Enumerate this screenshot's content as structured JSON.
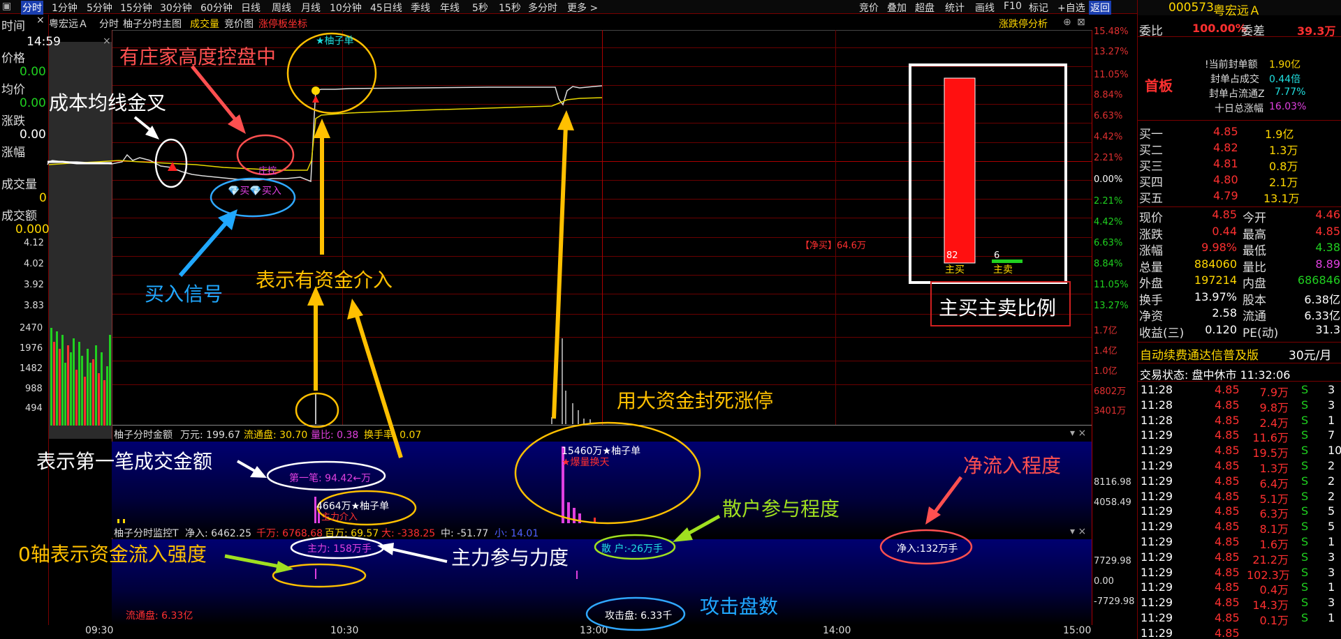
{
  "topbar": {
    "corner": "▣",
    "periods": [
      "分时",
      "1分钟",
      "5分钟",
      "15分钟",
      "30分钟",
      "60分钟",
      "日线",
      "周线",
      "月线",
      "10分钟",
      "45日线",
      "季线",
      "年线",
      "5秒",
      "15秒",
      "多分时",
      "更多 >"
    ],
    "right_buttons": [
      "竞价",
      "叠加",
      "超盘",
      "统计",
      "画线",
      "F10",
      "标记",
      "+自选",
      "返回"
    ]
  },
  "chart_header": {
    "time_label": "时间",
    "close": "×",
    "stock_name": "粤宏远Ａ",
    "mode": "分时",
    "main": "柚子分时主图",
    "vol": "成交量",
    "bid": "竞价图",
    "coord": "涨停板坐标",
    "analysis": "涨跌停分析"
  },
  "left_values": {
    "time": "14:59",
    "price_label": "价格",
    "price": "0.00",
    "avg_label": "均价",
    "avg": "0.00",
    "chg_label": "涨跌",
    "chg": "0.00",
    "pct_label": "涨幅",
    "pct": "0.00",
    "vol_label": "成交量",
    "vol": "0",
    "amt_label": "成交额",
    "amt": "0.000"
  },
  "left_price_ticks": [
    "4.12",
    "4.02",
    "3.92",
    "3.83"
  ],
  "left_vol_ticks": [
    "2470",
    "1976",
    "1482",
    "988",
    "494"
  ],
  "right_pct_ticks": [
    "15.48%",
    "13.27%",
    "11.05%",
    "8.84%",
    "6.63%",
    "4.42%",
    "2.21%",
    "0.00%",
    "2.21%",
    "4.42%",
    "6.63%",
    "8.84%",
    "11.05%",
    "13.27%"
  ],
  "right_vol_ticks": [
    "1.7亿",
    "1.4亿",
    "1.0亿",
    "6802万",
    "3401万"
  ],
  "chart_labels": {
    "star_single": "★柚子单",
    "retail_inline": "净买",
    "net_buy": "【净买】64.6万",
    "buy_signal_text": "买入",
    "gold_cross_text": "庄控"
  },
  "bar_panel": {
    "main_buy": "主买",
    "main_sell": "主卖",
    "main_buy_val": "82",
    "main_sell_val": "6"
  },
  "ind1": {
    "title": "柚子分时金额",
    "unit": "万元: 199.67",
    "float": "流通盘: 30.70",
    "vol_ratio": "量比: 0.38",
    "turnover": "换手率: 0.07",
    "axis_hi": "8116.98",
    "axis_mid": "4058.49",
    "first": "第一笔: 94.42←万",
    "big1": "4664万★柚子单",
    "big1b": "主力介入",
    "big2": "15460万★柚子单",
    "big2b": "★爆量换天"
  },
  "ind2": {
    "title": "柚子分时监控T",
    "net": "净入: 6462.25",
    "k": "千万: 6768.68",
    "b": "百万: 69.57",
    "big": "大: -338.25",
    "mid": "中: -51.77",
    "small": "小: 14.01",
    "main_force": "主力: 158万手",
    "retail": "散 户:-26万手",
    "netin": "净入:132万手",
    "attack": "攻击盘: 6.33千",
    "float": "流通盘: 6.33亿",
    "axis_hi": "7729.98",
    "axis_mid": "0.00",
    "axis_lo": "-7729.98"
  },
  "time_axis": [
    "09:30",
    "10:30",
    "13:00",
    "14:00",
    "15:00"
  ],
  "annotations": {
    "zhuang": "有庄家高度控盘中",
    "cost": "成本均线金叉",
    "buy": "买入信号",
    "fund": "表示有资金介入",
    "seal": "用大资金封死涨停",
    "first": "表示第一笔成交金额",
    "zero": "0轴表示资金流入强度",
    "main_force": "主力参与力度",
    "retail": "散户参与程度",
    "netflow": "净流入程度",
    "attack": "攻击盘数",
    "ratio": "主买主卖比例"
  },
  "sidebar": {
    "code": "000573",
    "name": "粤宏远Ａ",
    "wb_label": "委比",
    "wb": "100.00%",
    "wc_label": "委差",
    "wc": "39.3万",
    "first_board": "首板",
    "seal_info": [
      {
        "label": "!当前封单额",
        "value": "1.90亿"
      },
      {
        "label": "封单占成交",
        "value": "0.44倍"
      },
      {
        "label": "封单占流通Z",
        "value": "7.77%"
      },
      {
        "label": "十日总涨幅",
        "value": "16.03%"
      }
    ],
    "bids": [
      {
        "label": "买一",
        "price": "4.85",
        "vol": "1.9亿"
      },
      {
        "label": "买二",
        "price": "4.82",
        "vol": "1.3万"
      },
      {
        "label": "买三",
        "price": "4.81",
        "vol": "0.8万"
      },
      {
        "label": "买四",
        "price": "4.80",
        "vol": "2.1万"
      },
      {
        "label": "买五",
        "price": "4.79",
        "vol": "13.1万"
      }
    ],
    "quote": [
      {
        "l1": "现价",
        "v1": "4.85",
        "l2": "今开",
        "v2": "4.46"
      },
      {
        "l1": "涨跌",
        "v1": "0.44",
        "l2": "最高",
        "v2": "4.85"
      },
      {
        "l1": "涨幅",
        "v1": "9.98%",
        "l2": "最低",
        "v2": "4.38"
      },
      {
        "l1": "总量",
        "v1": "884060",
        "l2": "量比",
        "v2": "8.89"
      },
      {
        "l1": "外盘",
        "v1": "197214",
        "l2": "内盘",
        "v2": "686846"
      },
      {
        "l1": "换手",
        "v1": "13.97%",
        "l2": "股本",
        "v2": "6.38亿"
      },
      {
        "l1": "净资",
        "v1": "2.58",
        "l2": "流通",
        "v2": "6.33亿"
      },
      {
        "l1": "收益(三)",
        "v1": "0.120",
        "l2": "PE(动)",
        "v2": "31.3"
      }
    ],
    "promo": "自动续费通达信普及版",
    "promo_price": "30元/月",
    "status": "交易状态: 盘中休市 11:32:06",
    "trades": [
      {
        "t": "11:28",
        "p": "4.85",
        "v": "7.9万",
        "s": "S",
        "n": "3"
      },
      {
        "t": "11:28",
        "p": "4.85",
        "v": "9.8万",
        "s": "S",
        "n": "3"
      },
      {
        "t": "11:28",
        "p": "4.85",
        "v": "2.4万",
        "s": "S",
        "n": "1"
      },
      {
        "t": "11:29",
        "p": "4.85",
        "v": "11.6万",
        "s": "S",
        "n": "7"
      },
      {
        "t": "11:29",
        "p": "4.85",
        "v": "19.5万",
        "s": "S",
        "n": "10"
      },
      {
        "t": "11:29",
        "p": "4.85",
        "v": "1.3万",
        "s": "S",
        "n": "2"
      },
      {
        "t": "11:29",
        "p": "4.85",
        "v": "6.4万",
        "s": "S",
        "n": "2"
      },
      {
        "t": "11:29",
        "p": "4.85",
        "v": "5.1万",
        "s": "S",
        "n": "2"
      },
      {
        "t": "11:29",
        "p": "4.85",
        "v": "6.3万",
        "s": "S",
        "n": "5"
      },
      {
        "t": "11:29",
        "p": "4.85",
        "v": "8.1万",
        "s": "S",
        "n": "5"
      },
      {
        "t": "11:29",
        "p": "4.85",
        "v": "1.6万",
        "s": "S",
        "n": "1"
      },
      {
        "t": "11:29",
        "p": "4.85",
        "v": "21.2万",
        "s": "S",
        "n": "3"
      },
      {
        "t": "11:29",
        "p": "4.85",
        "v": "102.3万",
        "s": "S",
        "n": "3"
      },
      {
        "t": "11:29",
        "p": "4.85",
        "v": "0.4万",
        "s": "S",
        "n": "1"
      },
      {
        "t": "11:29",
        "p": "4.85",
        "v": "14.3万",
        "s": "S",
        "n": "3"
      },
      {
        "t": "11:29",
        "p": "4.85",
        "v": "0.1万",
        "s": "S",
        "n": "1"
      },
      {
        "t": "11:29",
        "p": "4.85",
        "v": "",
        "s": "",
        "n": ""
      }
    ]
  }
}
